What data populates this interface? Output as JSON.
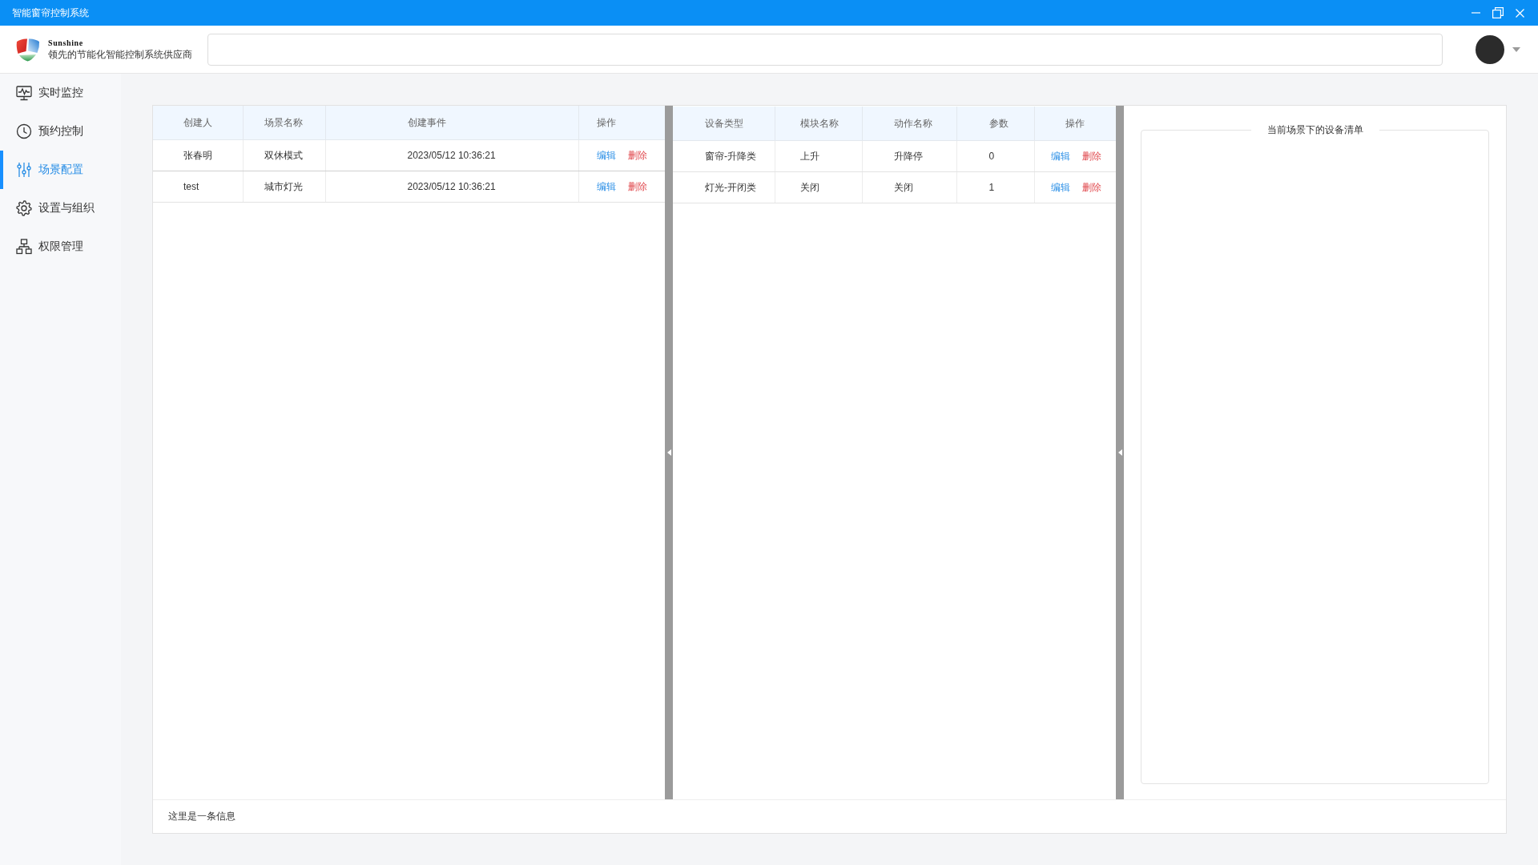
{
  "window": {
    "title": "智能窗帘控制系统"
  },
  "header": {
    "brand": "Sunshine",
    "tagline": "领先的节能化智能控制系统供应商"
  },
  "sidebar": {
    "items": [
      {
        "label": "实时监控",
        "selected": false
      },
      {
        "label": "预约控制",
        "selected": false
      },
      {
        "label": "场景配置",
        "selected": true
      },
      {
        "label": "设置与组织",
        "selected": false
      },
      {
        "label": "权限管理",
        "selected": false
      }
    ]
  },
  "scenes_table": {
    "columns": [
      "创建人",
      "场景名称",
      "创建事件",
      "操作"
    ],
    "rows": [
      {
        "cells": [
          "张春明",
          "双休模式",
          "2023/05/12 10:36:21"
        ],
        "actions": [
          {
            "kind": "edit",
            "label": "编辑"
          },
          {
            "kind": "delete",
            "label": "删除"
          }
        ]
      },
      {
        "cells": [
          "test",
          "城市灯光",
          "2023/05/12 10:36:21"
        ],
        "actions": [
          {
            "kind": "edit",
            "label": "编辑"
          },
          {
            "kind": "delete",
            "label": "删除"
          }
        ]
      }
    ]
  },
  "devices_table": {
    "columns": [
      "设备类型",
      "模块名称",
      "动作名称",
      "参数",
      "操作"
    ],
    "rows": [
      {
        "cells": [
          "窗帘-升降类",
          "上升",
          "升降停",
          "0"
        ],
        "actions": [
          {
            "kind": "edit",
            "label": "编辑"
          },
          {
            "kind": "delete",
            "label": "删除"
          }
        ]
      },
      {
        "cells": [
          "灯光-开闭类",
          "关闭",
          "关闭",
          "1"
        ],
        "actions": [
          {
            "kind": "edit",
            "label": "编辑"
          },
          {
            "kind": "delete",
            "label": "删除"
          }
        ]
      }
    ]
  },
  "device_list": {
    "title": "当前场景下的设备清单"
  },
  "status_bar": {
    "message": "这里是一条信息"
  }
}
